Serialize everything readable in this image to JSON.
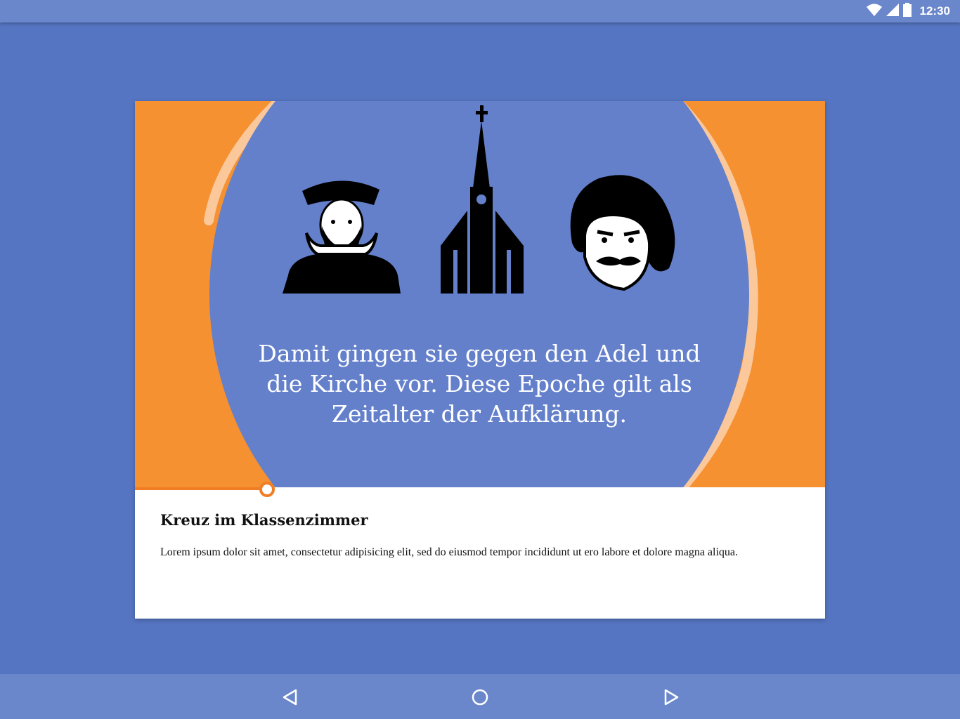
{
  "status_bar": {
    "time": "12:30",
    "icons": [
      "wifi-icon",
      "cell-signal-icon",
      "battery-icon"
    ]
  },
  "card": {
    "caption": "Damit gingen sie gegen den Adel und die Kirche vor. Diese Epoche gilt als Zeitalter der Aufklärung.",
    "title": "Kreuz im Klassenzimmer",
    "body": "Lorem ipsum dolor sit amet, consectetur adipisicing elit, sed do eiusmod tempor incididunt ut ero labore et dolore magna aliqua.",
    "illustrations": [
      "reformer-portrait",
      "church-icon",
      "philosopher-portrait"
    ]
  },
  "nav_bar": {
    "buttons": [
      "back-icon",
      "home-icon",
      "forward-icon"
    ]
  },
  "colors": {
    "background": "#5575c2",
    "bars": "#6b87cc",
    "hero_orange": "#f59131",
    "hero_circle": "#6480ca",
    "accent": "#f07c24"
  }
}
